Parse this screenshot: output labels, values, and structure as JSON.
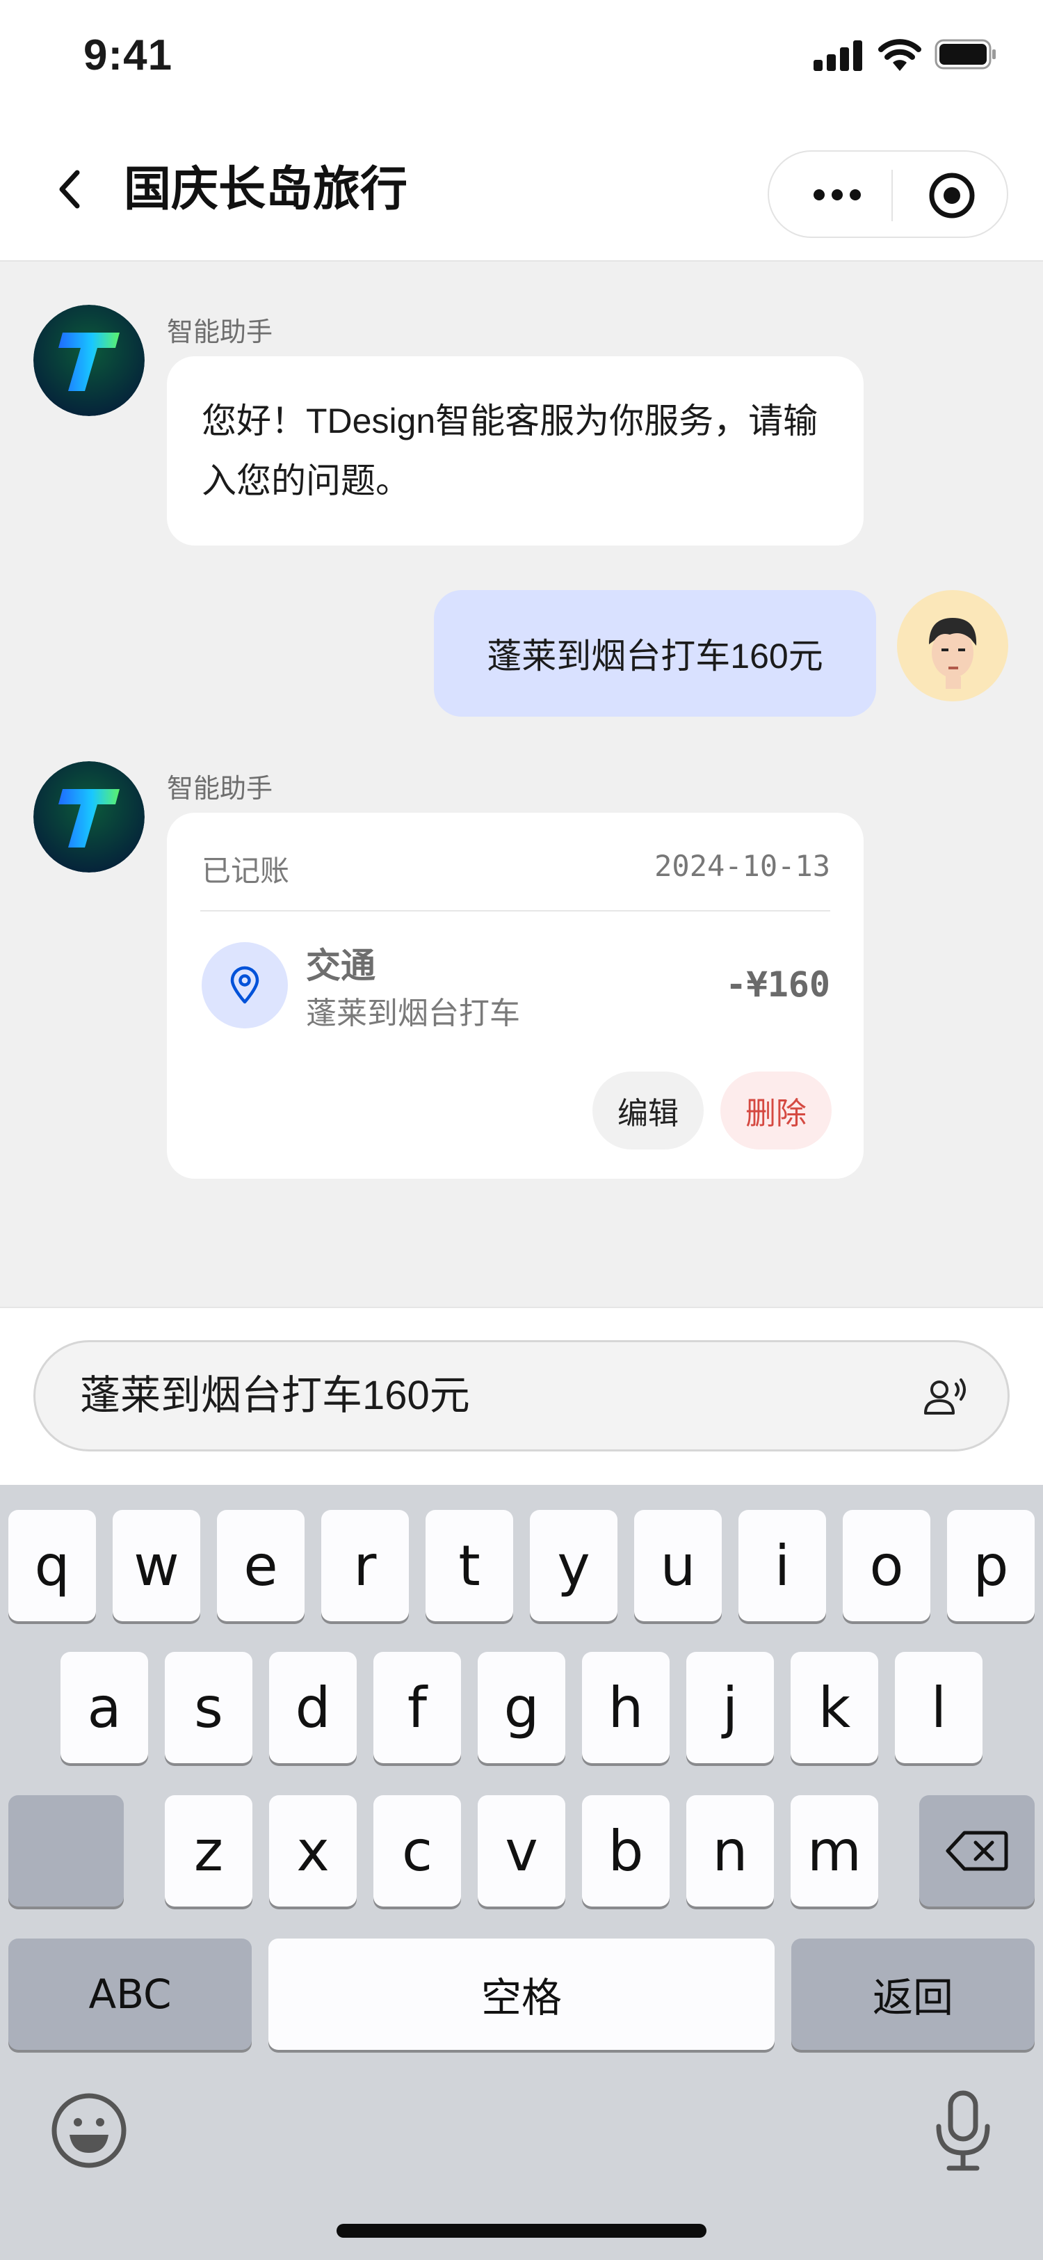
{
  "status_bar": {
    "time": "9:41"
  },
  "nav": {
    "title": "国庆长岛旅行"
  },
  "chat": {
    "bot_name": "智能助手",
    "greeting": "您好！TDesign智能客服为你服务，请输入您的问题。",
    "user_message": "蓬莱到烟台打车160元",
    "record_card": {
      "status": "已记账",
      "date": "2024-10-13",
      "category": "交通",
      "description": "蓬莱到烟台打车",
      "amount": "-¥160",
      "edit_label": "编辑",
      "delete_label": "删除"
    }
  },
  "input": {
    "value": "蓬莱到烟台打车160元"
  },
  "keyboard": {
    "row1": [
      "q",
      "w",
      "e",
      "r",
      "t",
      "y",
      "u",
      "i",
      "o",
      "p"
    ],
    "row2": [
      "a",
      "s",
      "d",
      "f",
      "g",
      "h",
      "j",
      "k",
      "l"
    ],
    "row3": [
      "z",
      "x",
      "c",
      "v",
      "b",
      "n",
      "m"
    ],
    "abc_label": "ABC",
    "space_label": "空格",
    "return_label": "返回"
  },
  "colors": {
    "accent": "#0052d9",
    "user_bubble": "#d9e1ff",
    "delete": "#d54941",
    "chat_bg": "#f0f0f0",
    "keyboard_bg": "#d1d4d9"
  },
  "icons": [
    "signal-icon",
    "wifi-icon",
    "battery-icon",
    "back-icon",
    "more-icon",
    "record-icon",
    "location-pin-icon",
    "voice-input-icon",
    "backspace-icon",
    "emoji-icon",
    "microphone-icon"
  ]
}
